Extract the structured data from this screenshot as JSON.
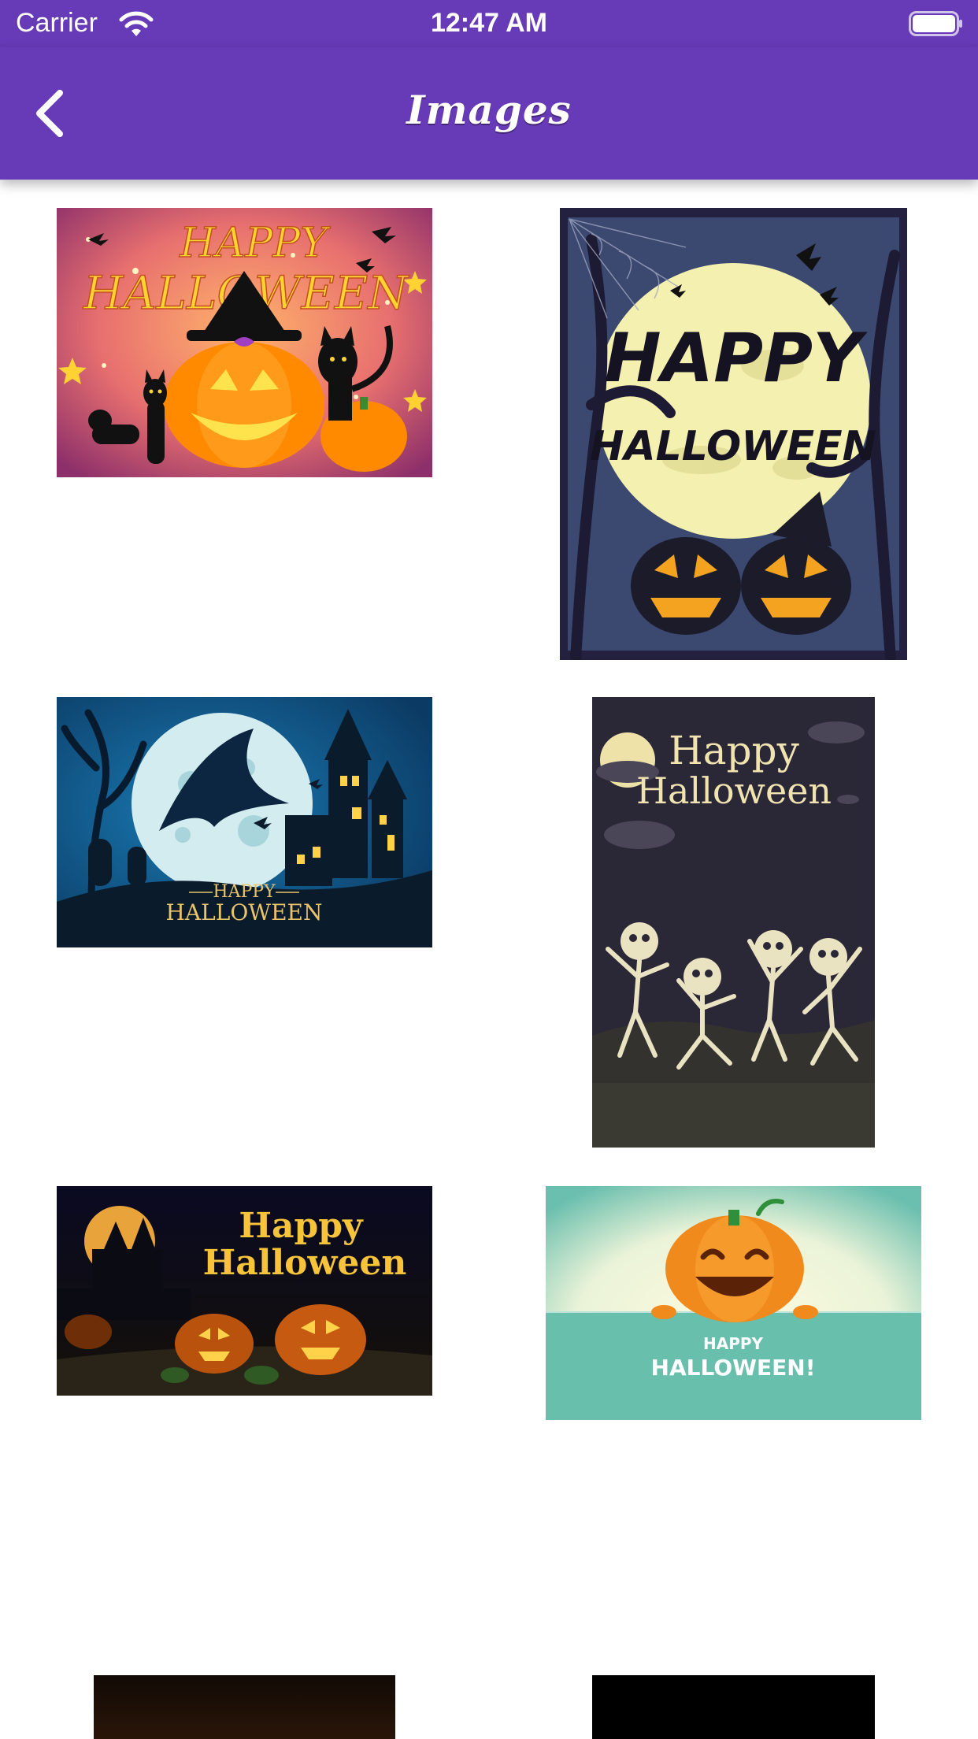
{
  "status_bar": {
    "carrier": "Carrier",
    "time": "12:47 AM",
    "wifi_icon": "wifi-icon",
    "battery_icon": "battery-icon"
  },
  "nav": {
    "title": "Images",
    "back_icon": "chevron-left-icon"
  },
  "theme": {
    "accent": "#673ab7",
    "background": "#ffffff"
  },
  "images": [
    {
      "id": 1,
      "line1": "HAPPY",
      "line2": "HALLOWEEN"
    },
    {
      "id": 2,
      "line1": "HAPPY",
      "line2": "HALLOWEEN"
    },
    {
      "id": 3,
      "line1": "HAPPY",
      "line2": "HALLOWEEN"
    },
    {
      "id": 4,
      "line1": "Happy",
      "line2": "Halloween"
    },
    {
      "id": 5,
      "line1": "Happy",
      "line2": "Halloween"
    },
    {
      "id": 6,
      "line1": "HAPPY",
      "line2": "HALLOWEEN!"
    },
    {
      "id": 7
    },
    {
      "id": 8
    }
  ]
}
